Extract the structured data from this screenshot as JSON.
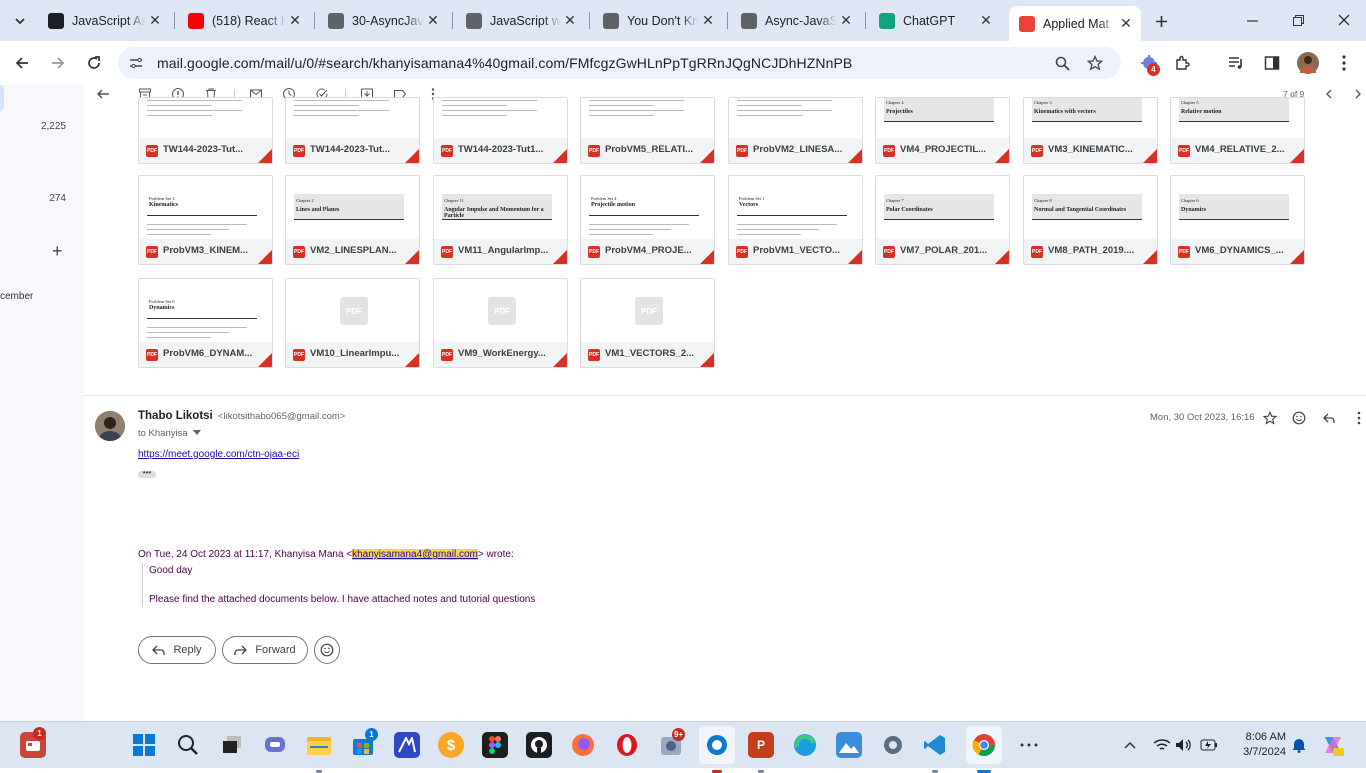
{
  "browser": {
    "tabs": [
      {
        "title": "JavaScript As",
        "icon": "angular-icon",
        "color": "#1b1f23"
      },
      {
        "title": "(518) React H",
        "icon": "youtube-icon",
        "color": "#ff0000"
      },
      {
        "title": "30-AsyncJava",
        "icon": "globe-icon",
        "color": "#5f6368"
      },
      {
        "title": "JavaScript wi",
        "icon": "globe-icon",
        "color": "#5f6368"
      },
      {
        "title": "You Don't Kn",
        "icon": "globe-icon",
        "color": "#5f6368"
      },
      {
        "title": "Async-JavaSc",
        "icon": "globe-icon",
        "color": "#5f6368"
      },
      {
        "title": "ChatGPT",
        "icon": "chatgpt-icon",
        "color": "#10a37f"
      },
      {
        "title": "Applied Mat",
        "icon": "gmail-icon",
        "color": "#ea4335"
      }
    ],
    "url": "mail.google.com/mail/u/0/#search/khanyisamana4%40gmail.com/FMfcgzGwHLnPpTgRRnJQgNCJDhHZNnPB",
    "extension_badge": "4"
  },
  "sidebar": {
    "counts": [
      "2,225",
      "274"
    ],
    "plus_label": "+",
    "partial_label": "cember"
  },
  "toolbar": {
    "pagination": "7 of 9"
  },
  "attachments": [
    {
      "name": "TW144-2023-Tut...",
      "thumb": "problems"
    },
    {
      "name": "TW144-2023-Tut...",
      "thumb": "problems"
    },
    {
      "name": "TW144-2023-Tut1...",
      "thumb": "problems"
    },
    {
      "name": "ProbVM5_RELATI...",
      "thumb": "problems"
    },
    {
      "name": "ProbVM2_LINESA...",
      "thumb": "problems"
    },
    {
      "name": "VM4_PROJECTIL...",
      "thumb": "chapter",
      "heading": "Projectiles",
      "chapter": "Chapter 4"
    },
    {
      "name": "VM3_KINEMATIC...",
      "thumb": "chapter",
      "heading": "Kinematics with vectors",
      "chapter": "Chapter 3"
    },
    {
      "name": "VM4_RELATIVE_2...",
      "thumb": "chapter",
      "heading": "Relative motion",
      "chapter": "Chapter 5"
    },
    {
      "name": "ProbVM3_KINEM...",
      "thumb": "problem-set",
      "heading": "Kinematics",
      "chapter": "Problem Set 3"
    },
    {
      "name": "VM2_LINESPLAN...",
      "thumb": "chapter",
      "heading": "Lines and Planes",
      "chapter": "Chapter 2"
    },
    {
      "name": "VM11_AngularImp...",
      "thumb": "chapter",
      "heading": "Angular Impulse and Momentum for a Particle",
      "chapter": "Chapter 11"
    },
    {
      "name": "ProbVM4_PROJE...",
      "thumb": "problem-set",
      "heading": "Projectile motion",
      "chapter": "Problem Set 4"
    },
    {
      "name": "ProbVM1_VECTO...",
      "thumb": "problem-set",
      "heading": "Vectors",
      "chapter": "Problem Set 1"
    },
    {
      "name": "VM7_POLAR_201...",
      "thumb": "chapter",
      "heading": "Polar Coordinates",
      "chapter": "Chapter 7"
    },
    {
      "name": "VM8_PATH_2019....",
      "thumb": "chapter",
      "heading": "Normal and Tangential Coordinates",
      "chapter": "Chapter 8"
    },
    {
      "name": "VM6_DYNAMICS_...",
      "thumb": "chapter",
      "heading": "Dynamics",
      "chapter": "Chapter 6"
    },
    {
      "name": "ProbVM6_DYNAM...",
      "thumb": "problem-set",
      "heading": "Dynamics",
      "chapter": "Problem Set 6"
    },
    {
      "name": "VM10_LinearImpu...",
      "thumb": "placeholder"
    },
    {
      "name": "VM9_WorkEnergy...",
      "thumb": "placeholder"
    },
    {
      "name": "VM1_VECTORS_2...",
      "thumb": "placeholder"
    }
  ],
  "message": {
    "sender_name": "Thabo Likotsi",
    "sender_email": "<likotsithabo065@gmail.com>",
    "to": "to Khanyisa",
    "date": "Mon, 30 Oct 2023, 16:16",
    "link": "https://meet.google.com/ctn-ojaa-eci",
    "ellipsis": "•••",
    "quote_prefix": "On Tue, 24 Oct 2023 at 11:17, Khanyisa Mana <",
    "quote_email": "khanyisamana4@gmail.com",
    "quote_suffix": "> wrote:",
    "quote_line1": "Good day",
    "quote_line2": "Please find the attached documents below. I have attached notes and tutorial questions"
  },
  "actions": {
    "reply": "Reply",
    "forward": "Forward"
  },
  "taskbar": {
    "time": "8:06 AM",
    "date": "3/7/2024",
    "badges": {
      "widgets": "1",
      "store": "1",
      "games": "9+"
    }
  }
}
